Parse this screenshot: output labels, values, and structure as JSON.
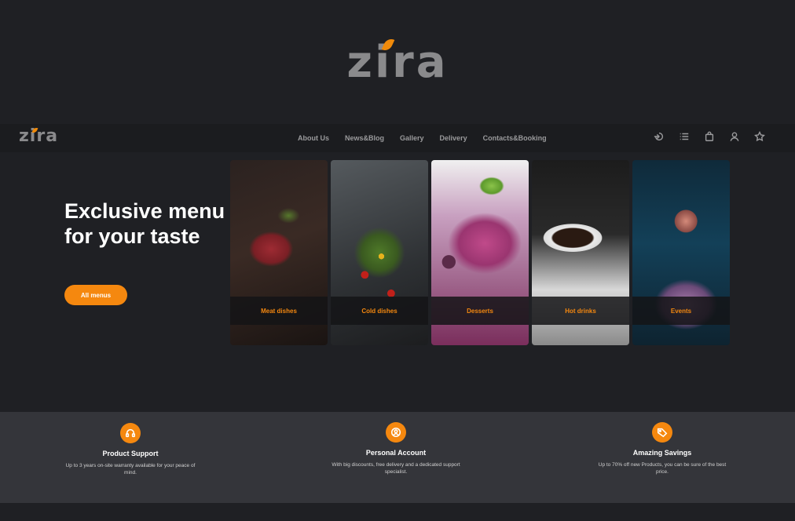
{
  "brand": {
    "logo_text": "zira",
    "accent_color": "#f5880f"
  },
  "nav": {
    "links": [
      "About Us",
      "News&Blog",
      "Gallery",
      "Delivery",
      "Contacts&Booking"
    ],
    "icons": [
      "login-icon",
      "list-icon",
      "bag-icon",
      "user-icon",
      "star-icon"
    ]
  },
  "hero": {
    "title": "Exclusive menu for your taste",
    "cta_label": "All menus"
  },
  "menu_cards": [
    {
      "label": "Meat dishes"
    },
    {
      "label": "Cold dishes"
    },
    {
      "label": "Desserts"
    },
    {
      "label": "Hot drinks"
    },
    {
      "label": "Events"
    }
  ],
  "features": [
    {
      "icon": "headset-icon",
      "title": "Product Support",
      "text": "Up to 3 years on-site warranty available for your peace of mind."
    },
    {
      "icon": "account-icon",
      "title": "Personal Account",
      "text": "With big discounts, free delivery and a dedicated support specialist."
    },
    {
      "icon": "tag-icon",
      "title": "Amazing Savings",
      "text": "Up to 70% off new Products, you can be sure of the best price."
    }
  ]
}
